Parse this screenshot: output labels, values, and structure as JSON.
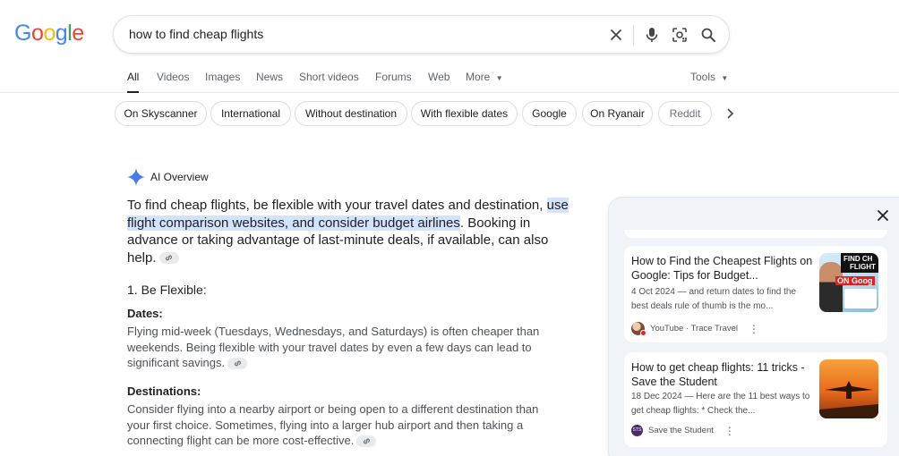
{
  "logo": {
    "letters": [
      "G",
      "o",
      "o",
      "g",
      "l",
      "e"
    ],
    "colors": [
      "#4285F4",
      "#EA4335",
      "#FBBC05",
      "#4285F4",
      "#34A853",
      "#EA4335"
    ]
  },
  "search": {
    "query": "how to find cheap flights"
  },
  "tabs": [
    "All",
    "Videos",
    "Images",
    "News",
    "Short videos",
    "Forums",
    "Web",
    "More"
  ],
  "tools_label": "Tools",
  "chips": [
    "On Skyscanner",
    "International",
    "Without destination",
    "With flexible dates",
    "Google",
    "On Ryanair",
    "Reddit"
  ],
  "ai": {
    "label": "AI Overview",
    "lead_a": "To find cheap flights, be flexible with your travel dates and destination, ",
    "lead_hl": "use flight comparison websites, and consider budget airlines",
    "lead_b": ". Booking in advance or taking advantage of last-minute deals, if available, can also help.",
    "section1": "1. Be Flexible:",
    "dates_h": "Dates:",
    "dates_p": "Flying mid-week (Tuesdays, Wednesdays, and Saturdays) is often cheaper than weekends. Being flexible with your travel dates by even a few days can lead to significant savings.",
    "dest_h": "Destinations:",
    "dest_p": "Consider flying into a nearby airport or being open to a different destination than your first choice. Sometimes, flying into a larger hub airport and then taking a connecting flight can be more cost-effective."
  },
  "sources": [
    {
      "title": "How to Find the Cheapest Flights on Google: Tips for Budget...",
      "snippet": "4 Oct 2024 — and return dates to find the best deals rule of thumb is the mo...",
      "source": "YouTube · Trace Travel",
      "thumb_text_a": "FIND CH",
      "thumb_text_b": "FLIGHT",
      "thumb_text_c": "ON Goog"
    },
    {
      "title": "How to get cheap flights: 11 tricks - Save the Student",
      "snippet": "18 Dec 2024 — Here are the 11 best ways to get cheap flights: * Check the...",
      "source": "Save the Student"
    }
  ]
}
